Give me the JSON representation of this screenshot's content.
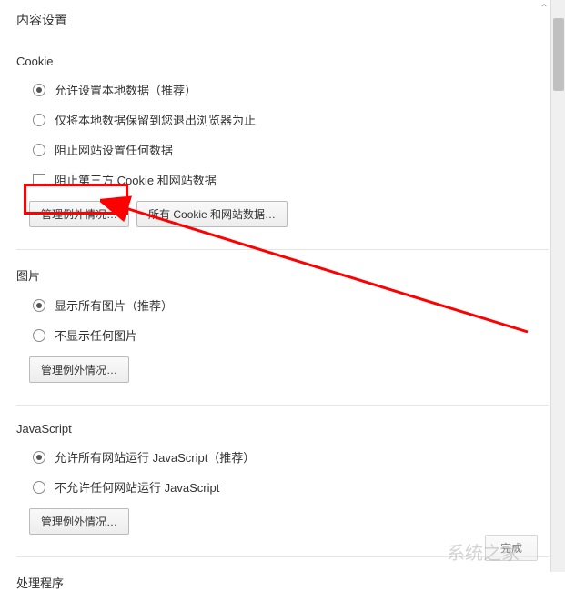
{
  "dialog": {
    "title": "内容设置"
  },
  "sections": {
    "cookie": {
      "title": "Cookie",
      "options": [
        {
          "label": "允许设置本地数据（推荐）",
          "checked": true
        },
        {
          "label": "仅将本地数据保留到您退出浏览器为止",
          "checked": false
        },
        {
          "label": "阻止网站设置任何数据",
          "checked": false
        }
      ],
      "checkbox": {
        "label": "阻止第三方 Cookie 和网站数据",
        "checked": false
      },
      "buttons": {
        "exceptions": "管理例外情况…",
        "allCookies": "所有 Cookie 和网站数据…"
      }
    },
    "images": {
      "title": "图片",
      "options": [
        {
          "label": "显示所有图片（推荐）",
          "checked": true
        },
        {
          "label": "不显示任何图片",
          "checked": false
        }
      ],
      "buttons": {
        "exceptions": "管理例外情况…"
      }
    },
    "javascript": {
      "title": "JavaScript",
      "options": [
        {
          "label": "允许所有网站运行 JavaScript（推荐）",
          "checked": true
        },
        {
          "label": "不允许任何网站运行 JavaScript",
          "checked": false
        }
      ],
      "buttons": {
        "exceptions": "管理例外情况…"
      }
    },
    "handlers": {
      "title": "处理程序"
    }
  },
  "footer": {
    "done": "完成"
  },
  "watermark": "系统之家"
}
